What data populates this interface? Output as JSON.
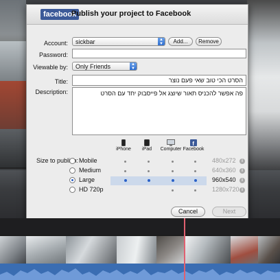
{
  "dialog": {
    "logo": "facebook",
    "title": "Publish your project to Facebook"
  },
  "form": {
    "account_label": "Account:",
    "account_value": "sickbar",
    "add_button": "Add...",
    "remove_button": "Remove",
    "password_label": "Password:",
    "password_value": "",
    "viewable_label": "Viewable by:",
    "viewable_value": "Only Friends",
    "title_label": "Title:",
    "title_value": "הסרט הכי טוב שאי פעם נוצר",
    "description_label": "Description:",
    "description_value": "פה אפשר להכניס תאור שיוצג אל פייסבוק יחד עם הסרט"
  },
  "devices": [
    {
      "label": "iPhone",
      "icon": "iphone-icon"
    },
    {
      "label": "iPad",
      "icon": "ipad-icon"
    },
    {
      "label": "Computer",
      "icon": "computer-icon"
    },
    {
      "label": "Facebook",
      "icon": "facebook-icon"
    }
  ],
  "size": {
    "label": "Size to publish:",
    "options": [
      {
        "label": "Mobile",
        "resolution": "480x272",
        "selected": false
      },
      {
        "label": "Medium",
        "resolution": "640x360",
        "selected": false
      },
      {
        "label": "Large",
        "resolution": "960x540",
        "selected": true
      },
      {
        "label": "HD 720p",
        "resolution": "1280x720",
        "selected": false
      }
    ]
  },
  "buttons": {
    "cancel": "Cancel",
    "next": "Next"
  },
  "colors": {
    "facebook_blue": "#3b5998",
    "selection_blue": "#2a61c8",
    "waveform_blue": "#3a6db2",
    "playhead": "#e06070"
  }
}
